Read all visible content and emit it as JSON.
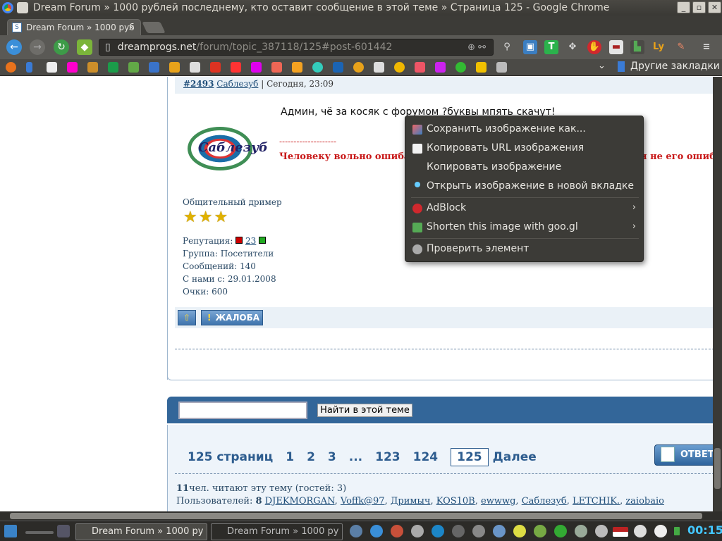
{
  "window": {
    "title": "Dream Forum » 1000 рублей последнему, кто оставит сообщение в этой теме » Страница 125 - Google Chrome",
    "controls": [
      "minimize",
      "maximize",
      "close"
    ]
  },
  "tabs": [
    {
      "label": "Dream Forum » 1000 руб",
      "active": true
    }
  ],
  "address_bar": {
    "host": "dreamprogs.net",
    "path": "/forum/topic_387118/125#post-601442"
  },
  "bookmarks": {
    "overflow_label": "Другие закладки"
  },
  "post": {
    "number": "#2493",
    "author": "Саблезуб",
    "time": "| Сегодня, 23:09",
    "avatar_text": "Саблезуб",
    "rank": "Общительный дример",
    "reputation_label": "Репутация:",
    "reputation_value": "23",
    "group": "Группа: Посетители",
    "messages": "Сообщений: 140",
    "since": "С нами с: 29.01.2008",
    "points": "Очки: 600",
    "message": "Админ, чё за косяк с форумом ?буквы мпять скачут!",
    "signature_line": "--------------------",
    "signature": "Человеку вольно ошибаться, но не на столько, чтоб ему указывали не его ошибки!!!",
    "report_label": "ЖАЛОБА"
  },
  "search": {
    "input_value": "",
    "button_label": "Найти в этой теме"
  },
  "pagination": {
    "summary": "125 страниц",
    "pages": [
      "1",
      "2",
      "3",
      "...",
      "123",
      "124"
    ],
    "current": "125",
    "next": "Далее",
    "reply_label": "ОТВЕТ"
  },
  "readers": {
    "count": "11",
    "text": "чел. читают эту тему (гостей: 3)",
    "users_label": "Пользователей:",
    "users_count": "8",
    "users": [
      "DJEKMORGAN",
      "Voffk@97",
      "Дримыч",
      "KOS10B",
      "ewwwg",
      "Саблезуб",
      "LETCHIK.",
      "zaiobaio"
    ]
  },
  "context_menu": {
    "items": [
      {
        "label": "Сохранить изображение как...",
        "icon": "save-image-icon"
      },
      {
        "label": "Копировать URL изображения",
        "icon": "copy-url-icon"
      },
      {
        "label": "Копировать изображение",
        "icon": ""
      },
      {
        "label": "Открыть изображение в новой вкладке",
        "icon": "new-tab-icon"
      },
      {
        "label": "AdBlock",
        "icon": "adblock-icon",
        "submenu": true
      },
      {
        "label": "Shorten this image with goo.gl",
        "icon": "googl-icon",
        "submenu": true
      },
      {
        "label": "Проверить элемент",
        "icon": "inspect-icon"
      }
    ]
  },
  "taskbar": {
    "windows": [
      "Dream Forum » 1000 ру",
      "Dream Forum » 1000 ру"
    ],
    "clock": "00:15"
  }
}
